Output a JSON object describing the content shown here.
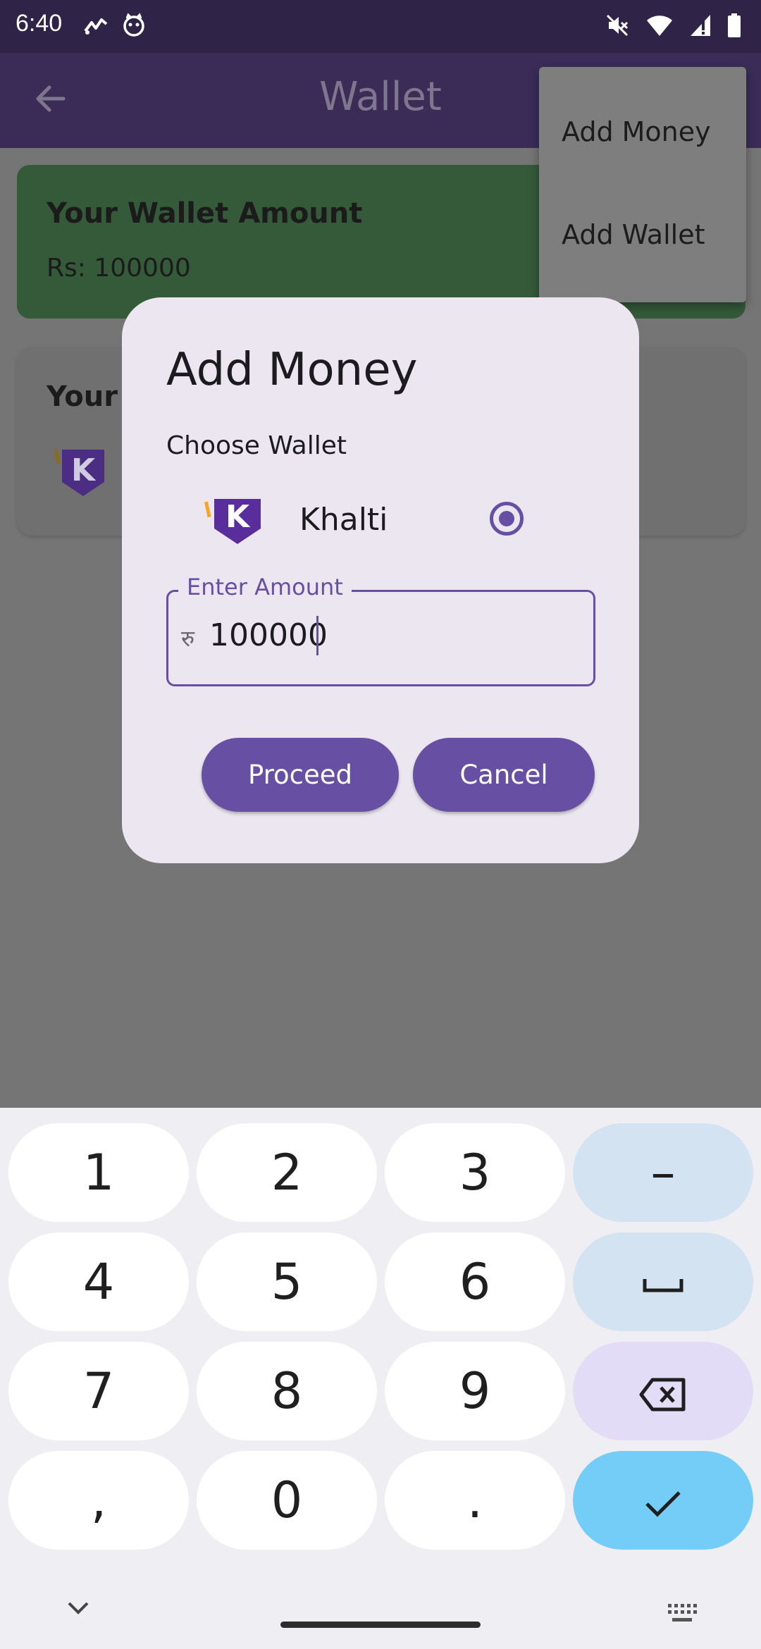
{
  "status_bar": {
    "time": "6:40",
    "left_icons": [
      "stocks-icon",
      "cat-face-icon"
    ],
    "right_icons": [
      "mute-icon",
      "wifi-icon",
      "signal-icon",
      "battery-icon"
    ]
  },
  "app_bar": {
    "title": "Wallet",
    "back_icon": "back-arrow-icon"
  },
  "wallet_card": {
    "title": "Your Wallet Amount",
    "amount": "Rs: 100000"
  },
  "wallets_card": {
    "title": "Your"
  },
  "popup_menu": {
    "items": [
      "Add Money",
      "Add Wallet"
    ]
  },
  "dialog": {
    "title": "Add Money",
    "choose_label": "Choose Wallet",
    "wallet_option": {
      "name": "Khalti",
      "selected": true,
      "logo_letter": "K"
    },
    "amount_field": {
      "label": "Enter Amount",
      "prefix": "रु",
      "value": "100000"
    },
    "buttons": {
      "proceed": "Proceed",
      "cancel": "Cancel"
    }
  },
  "keyboard": {
    "rows": [
      [
        "1",
        "2",
        "3",
        "–"
      ],
      [
        "4",
        "5",
        "6",
        "space"
      ],
      [
        "7",
        "8",
        "9",
        "backspace"
      ],
      [
        ",",
        "0",
        ".",
        "enter"
      ]
    ],
    "labels": {
      "k1": "1",
      "k2": "2",
      "k3": "3",
      "dash": "–",
      "k4": "4",
      "k5": "5",
      "k6": "6",
      "k7": "7",
      "k8": "8",
      "k9": "9",
      "comma": ",",
      "k0": "0",
      "period": "."
    }
  },
  "colors": {
    "primary": "#6750a4",
    "status_bar": "#2f2347",
    "dialog_bg": "#ece6f0",
    "wallet_card_green": "#345a3a",
    "enter_key": "#74cdf7"
  }
}
